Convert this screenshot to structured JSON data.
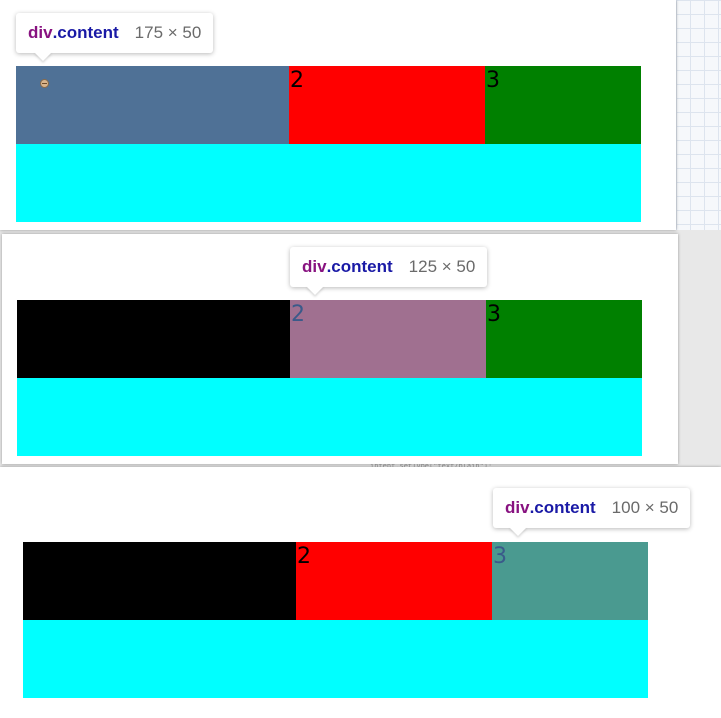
{
  "tooltip_common": {
    "tag": "div",
    "class_name": ".content"
  },
  "colors": {
    "tag": "#881280",
    "class": "#1a1aa6",
    "black": "#000000",
    "red": "#ff0000",
    "green": "#008000",
    "cyan": "#00ffff",
    "highlight_blue": "#4f7196",
    "highlight_purple": "#a07090",
    "highlight_teal": "#4a9a90"
  },
  "panels": [
    {
      "tooltip": {
        "size": "175 × 50"
      },
      "cells": [
        {
          "label": "",
          "color": "#4f7196"
        },
        {
          "label": "2",
          "color": "#ff0000"
        },
        {
          "label": "3",
          "color": "#008000"
        }
      ]
    },
    {
      "tooltip": {
        "size": "125 × 50"
      },
      "cells": [
        {
          "label": "",
          "color": "#000000"
        },
        {
          "label": "2",
          "color": "#a07090"
        },
        {
          "label": "3",
          "color": "#008000"
        }
      ]
    },
    {
      "tooltip": {
        "size": "100 × 50"
      },
      "cells": [
        {
          "label": "",
          "color": "#000000"
        },
        {
          "label": "2",
          "color": "#ff0000"
        },
        {
          "label": "3",
          "color": "#4a9a90"
        }
      ]
    }
  ],
  "bleed_text": "intent.setType(\"text/plain\");"
}
